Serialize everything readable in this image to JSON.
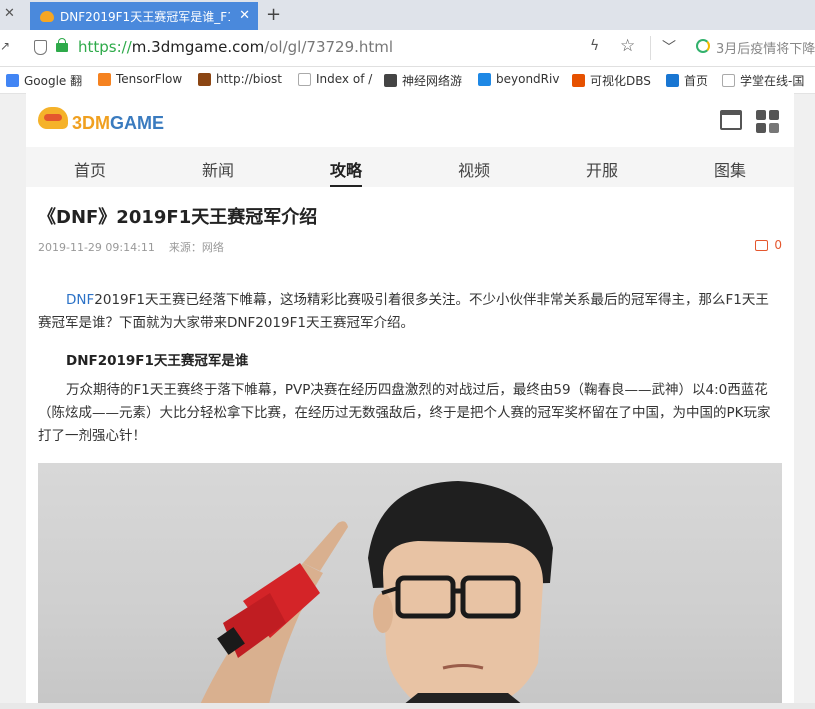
{
  "browser": {
    "tab_title": "DNF2019F1天王赛冠军是谁_F1",
    "url_proto": "https://",
    "url_host": "m.3dmgame.com",
    "url_path": "/ol/gl/73729.html",
    "search_hint": "3月后疫情将下降"
  },
  "bookmarks": [
    {
      "label": "Google 翻",
      "icon_color": "#4285f4"
    },
    {
      "label": "TensorFlow",
      "icon_color": "#f58220"
    },
    {
      "label": "http://biost",
      "icon_color": "#8b4513"
    },
    {
      "label": "Index of /",
      "icon_color": "#cccccc"
    },
    {
      "label": "神经网络游",
      "icon_color": "#444444"
    },
    {
      "label": "beyondRiv",
      "icon_color": "#1e88e5"
    },
    {
      "label": "可视化DBS",
      "icon_color": "#e65100"
    },
    {
      "label": "首页",
      "icon_color": "#1976d2"
    },
    {
      "label": "学堂在线-国",
      "icon_color": "#cccccc"
    }
  ],
  "site": {
    "logo_num": "3DM",
    "logo_word": "GAME",
    "nav": [
      "首页",
      "新闻",
      "攻略",
      "视频",
      "开服",
      "图集"
    ],
    "active_nav": "攻略"
  },
  "article": {
    "title": "《DNF》2019F1天王赛冠军介绍",
    "datetime": "2019-11-29 09:14:11",
    "source": "来源：网络",
    "comment_count": "0",
    "p1_link": "DNF",
    "p1_rest": "2019F1天王赛已经落下帷幕，这场精彩比赛吸引着很多关注。不少小伙伴非常关系最后的冠军得主，那么F1天王赛冠军是谁？下面就为大家带来DNF2019F1天王赛冠军介绍。",
    "subhead": "DNF2019F1天王赛冠军是谁",
    "p2": "万众期待的F1天王赛终于落下帷幕，PVP决赛在经历四盘激烈的对战过后，最终由59（鞠春良——武神）以4:0西蓝花（陈炫成——元素）大比分轻松拿下比赛，在经历过无数强敌后，终于是把个人赛的冠军奖杯留在了中国，为中国的PK玩家打了一剂强心针！"
  },
  "colors": {
    "accent_tab": "#4a89dc",
    "link": "#2c72c7",
    "comment": "#e4572e"
  }
}
